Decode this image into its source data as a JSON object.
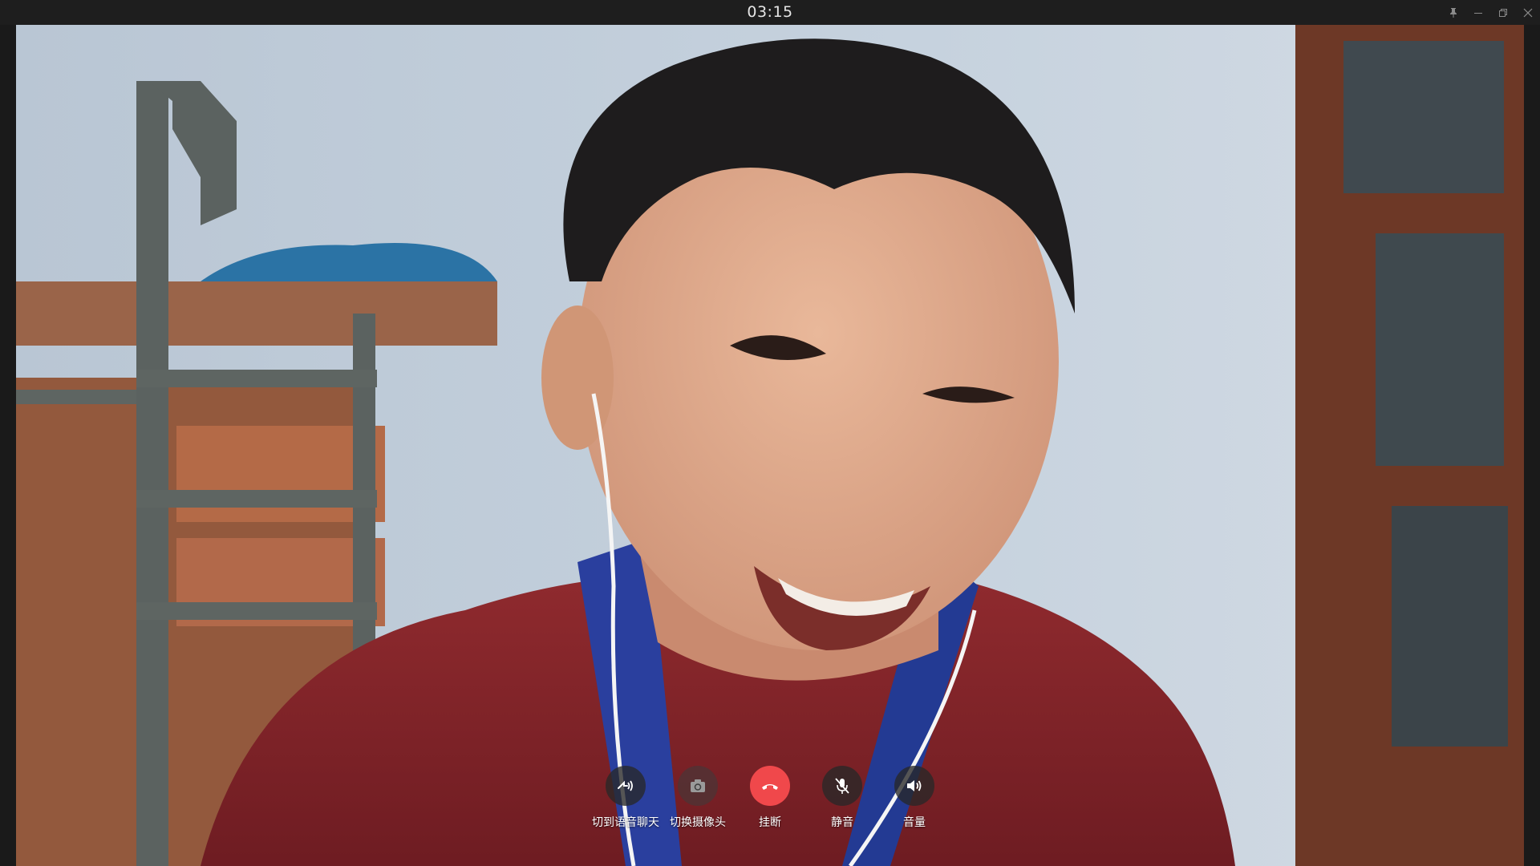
{
  "window": {
    "timer": "03:15",
    "controls": {
      "pin": "pin-icon",
      "minimize": "minimize-icon",
      "restore": "restore-icon",
      "close": "close-icon"
    }
  },
  "call_controls": [
    {
      "label": "切到语音聊天",
      "icon": "voice-switch-icon",
      "color": "#2a2a2a"
    },
    {
      "label": "切换摄像头",
      "icon": "camera-switch-icon",
      "color": "#3c3c3c"
    },
    {
      "label": "挂断",
      "icon": "hang-up-icon",
      "color": "#f0484b"
    },
    {
      "label": "静音",
      "icon": "mute-mic-icon",
      "color": "#2a2a2a"
    },
    {
      "label": "音量",
      "icon": "volume-icon",
      "color": "#2a2a2a"
    }
  ]
}
